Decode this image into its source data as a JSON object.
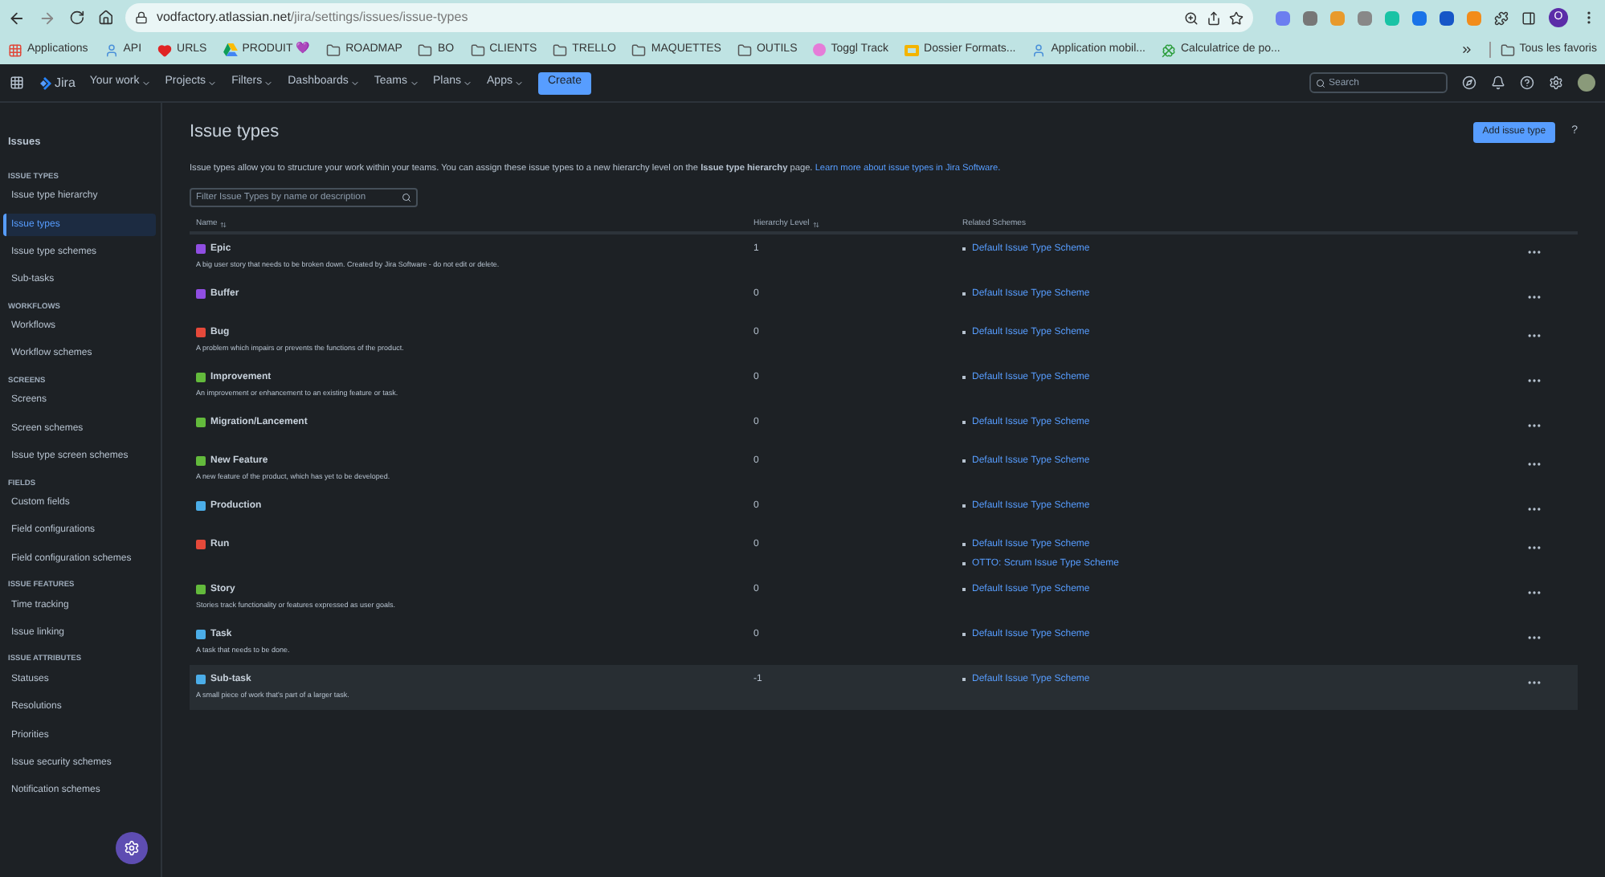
{
  "browser": {
    "url_host": "vodfactory.atlassian.net",
    "url_path": "/jira/settings/issues/issue-types",
    "profile": "O"
  },
  "bookmark_items": [
    {
      "label": "Applications",
      "kind": "apps"
    },
    {
      "label": "API",
      "kind": "person"
    },
    {
      "label": "URLS",
      "kind": "heart"
    },
    {
      "label": "PRODUIT 💜",
      "kind": "drive"
    },
    {
      "label": "ROADMAP",
      "kind": "folder"
    },
    {
      "label": "BO",
      "kind": "folder"
    },
    {
      "label": "CLIENTS",
      "kind": "folder"
    },
    {
      "label": "TRELLO",
      "kind": "folder"
    },
    {
      "label": "MAQUETTES",
      "kind": "folder"
    },
    {
      "label": "OUTILS",
      "kind": "folder"
    },
    {
      "label": "Toggl Track",
      "kind": "toggl"
    },
    {
      "label": "Dossier Formats...",
      "kind": "slides"
    },
    {
      "label": "Application mobil...",
      "kind": "person"
    },
    {
      "label": "Calculatrice de po...",
      "kind": "clover"
    }
  ],
  "other_bookmarks": "Tous les favoris",
  "nav": {
    "product": "Jira",
    "items": [
      "Your work",
      "Projects",
      "Filters",
      "Dashboards",
      "Teams",
      "Plans",
      "Apps"
    ],
    "create": "Create",
    "search_placeholder": "Search"
  },
  "sidebar": {
    "title": "Issues",
    "sections": [
      {
        "heading": "ISSUE TYPES",
        "items": [
          {
            "label": "Issue type hierarchy",
            "selected": false
          },
          {
            "label": "Issue types",
            "selected": true
          },
          {
            "label": "Issue type schemes",
            "selected": false
          },
          {
            "label": "Sub-tasks",
            "selected": false
          }
        ]
      },
      {
        "heading": "WORKFLOWS",
        "items": [
          {
            "label": "Workflows",
            "selected": false
          },
          {
            "label": "Workflow schemes",
            "selected": false
          }
        ]
      },
      {
        "heading": "SCREENS",
        "items": [
          {
            "label": "Screens",
            "selected": false
          },
          {
            "label": "Screen schemes",
            "selected": false
          },
          {
            "label": "Issue type screen schemes",
            "selected": false
          }
        ]
      },
      {
        "heading": "FIELDS",
        "items": [
          {
            "label": "Custom fields",
            "selected": false
          },
          {
            "label": "Field configurations",
            "selected": false
          },
          {
            "label": "Field configuration schemes",
            "selected": false
          }
        ]
      },
      {
        "heading": "ISSUE FEATURES",
        "items": [
          {
            "label": "Time tracking",
            "selected": false
          },
          {
            "label": "Issue linking",
            "selected": false
          }
        ]
      },
      {
        "heading": "ISSUE ATTRIBUTES",
        "items": [
          {
            "label": "Statuses",
            "selected": false
          },
          {
            "label": "Resolutions",
            "selected": false
          },
          {
            "label": "Priorities",
            "selected": false
          },
          {
            "label": "Issue security schemes",
            "selected": false
          },
          {
            "label": "Notification schemes",
            "selected": false
          }
        ]
      }
    ]
  },
  "page": {
    "title": "Issue types",
    "add_button": "Add issue type",
    "help": "?",
    "intro": "Issue types allow you to structure your work within your teams. You can assign these issue types to a new hierarchy level on the **Issue type hierarchy** page.",
    "intro_link": "Learn more about issue types in Jira Software.",
    "filter_placeholder": "Filter Issue Types by name or description"
  },
  "table": {
    "columns": [
      {
        "label": "Name",
        "sortable": true
      },
      {
        "label": "Hierarchy Level",
        "sortable": true
      },
      {
        "label": "Related Schemes",
        "sortable": false
      }
    ],
    "rows": [
      {
        "name": "Epic",
        "color": "#904ee2",
        "description": "A big user story that needs to be broken down. Created by Jira Software - do not edit or delete.",
        "level": "1",
        "schemes": [
          "Default Issue Type Scheme"
        ],
        "selected": false
      },
      {
        "name": "Buffer",
        "color": "#904ee2",
        "level": "0",
        "schemes": [
          "Default Issue Type Scheme"
        ],
        "selected": false
      },
      {
        "name": "Bug",
        "color": "#e5493a",
        "description": "A problem which impairs or prevents the functions of the product.",
        "level": "0",
        "schemes": [
          "Default Issue Type Scheme"
        ],
        "selected": false
      },
      {
        "name": "Improvement",
        "color": "#63ba3c",
        "description": "An improvement or enhancement to an existing feature or task.",
        "level": "0",
        "schemes": [
          "Default Issue Type Scheme"
        ],
        "selected": false
      },
      {
        "name": "Migration/Lancement",
        "color": "#63ba3c",
        "level": "0",
        "schemes": [
          "Default Issue Type Scheme"
        ],
        "selected": false
      },
      {
        "name": "New Feature",
        "color": "#63ba3c",
        "description": "A new feature of the product, which has yet to be developed.",
        "level": "0",
        "schemes": [
          "Default Issue Type Scheme"
        ],
        "selected": false
      },
      {
        "name": "Production",
        "color": "#4bade8",
        "level": "0",
        "schemes": [
          "Default Issue Type Scheme"
        ],
        "selected": false
      },
      {
        "name": "Run",
        "color": "#e5493a",
        "level": "0",
        "schemes": [
          "Default Issue Type Scheme",
          "OTTO: Scrum Issue Type Scheme"
        ],
        "selected": false
      },
      {
        "name": "Story",
        "color": "#63ba3c",
        "description": "Stories track functionality or features expressed as user goals.",
        "level": "0",
        "schemes": [
          "Default Issue Type Scheme"
        ],
        "selected": false
      },
      {
        "name": "Task",
        "color": "#4bade8",
        "description": "A task that needs to be done.",
        "level": "0",
        "schemes": [
          "Default Issue Type Scheme"
        ],
        "selected": false
      },
      {
        "name": "Sub-task",
        "color": "#4bade8",
        "description": "A small piece of work that's part of a larger task.",
        "level": "-1",
        "schemes": [
          "Default Issue Type Scheme"
        ],
        "selected": true
      }
    ]
  }
}
